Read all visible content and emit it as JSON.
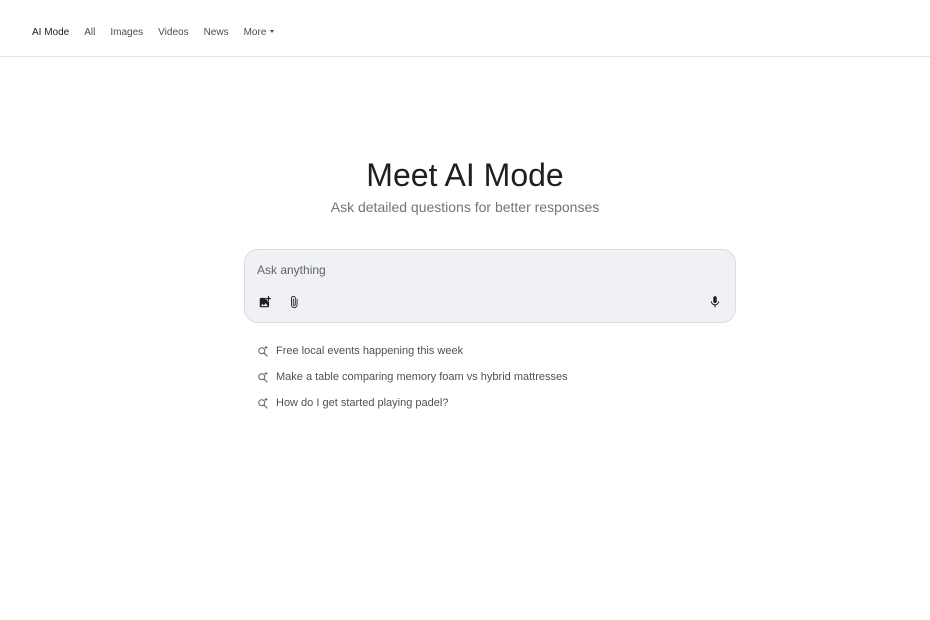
{
  "nav": {
    "tabs": [
      {
        "label": "AI Mode",
        "active": true
      },
      {
        "label": "All"
      },
      {
        "label": "Images"
      },
      {
        "label": "Videos"
      },
      {
        "label": "News"
      },
      {
        "label": "More"
      }
    ]
  },
  "hero": {
    "title": "Meet AI Mode",
    "subtitle": "Ask detailed questions for better responses"
  },
  "search": {
    "placeholder": "Ask anything",
    "value": "",
    "icons": [
      "add-image-icon",
      "paperclip-icon",
      "microphone-icon"
    ]
  },
  "suggestions": [
    {
      "text": "Free local events happening this week",
      "icon": "search-sparkle-icon"
    },
    {
      "text": "Make a table comparing memory foam vs hybrid mattresses",
      "icon": "search-sparkle-icon"
    },
    {
      "text": "How do I get started playing padel?",
      "icon": "search-sparkle-icon"
    }
  ],
  "colors": {
    "background": "#ffffff",
    "search_box": "#f0f1f5",
    "border": "#dadce0",
    "subtitle_text": "#70757a"
  }
}
